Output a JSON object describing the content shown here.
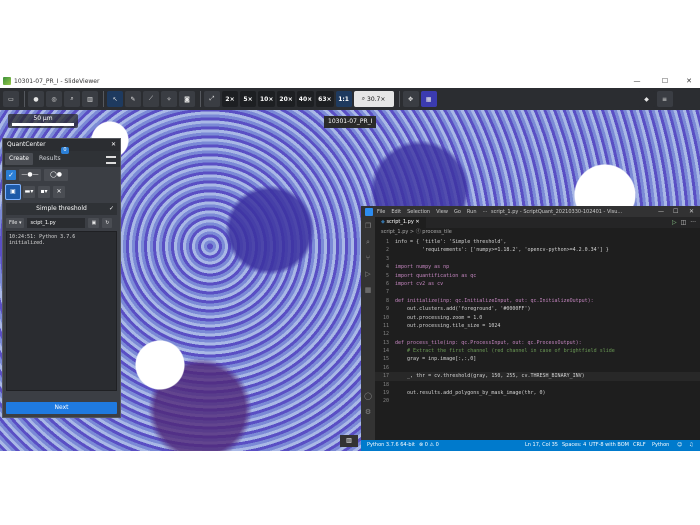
{
  "window": {
    "title": "10301-07_PR_I - SlideViewer",
    "controls": [
      "—",
      "☐",
      "✕"
    ]
  },
  "toolbar": {
    "zoom_levels": [
      "2×",
      "5×",
      "10×",
      "20×",
      "40×",
      "63×",
      "1:1"
    ],
    "zoom_value": "30.7×"
  },
  "viewer": {
    "scalebar_label": "50 μm",
    "slide_label": "10301-07_PR_I"
  },
  "quantcenter": {
    "title": "QuantCenter",
    "tabs": [
      {
        "label": "Create"
      },
      {
        "label": "Results",
        "badge": "0"
      }
    ],
    "section_title": "Simple threshold",
    "file_label": "File ▾",
    "script_name": "scipt_1.py",
    "console_line": "10:24:51: Python 3.7.6 initialized.",
    "next_label": "Next"
  },
  "vscode": {
    "menus": [
      "File",
      "Edit",
      "Selection",
      "View",
      "Go",
      "Run",
      "···"
    ],
    "title": "script_1.py - ScriptQuant_20210330-102401 - Visu...",
    "tab_label": "script_1.py",
    "breadcrumb": "script_1.py > ⓕ process_tile",
    "code": [
      {
        "n": "1",
        "t": "info = { 'title': 'Simple threshold',"
      },
      {
        "n": "2",
        "t": "         'requirements': ['numpy>=1.18.2', 'opencv-python>=4.2.0.34'] }"
      },
      {
        "n": "3",
        "t": ""
      },
      {
        "n": "4",
        "t": "import numpy as np"
      },
      {
        "n": "5",
        "t": "import quantification as qc"
      },
      {
        "n": "6",
        "t": "import cv2 as cv"
      },
      {
        "n": "7",
        "t": ""
      },
      {
        "n": "8",
        "t": "def initialize(inp: qc.InitializeInput, out: qc.InitializeOutput):"
      },
      {
        "n": "9",
        "t": "    out.clusters.add('foreground', '#0000FF')"
      },
      {
        "n": "10",
        "t": "    out.processing.zoom = 1.0"
      },
      {
        "n": "11",
        "t": "    out.processing.tile_size = 1024"
      },
      {
        "n": "12",
        "t": ""
      },
      {
        "n": "13",
        "t": "def process_tile(inp: qc.ProcessInput, out: qc.ProcessOutput):"
      },
      {
        "n": "14",
        "t": "    # Extract the first channel (red channel in case of brightfield slide"
      },
      {
        "n": "15",
        "t": "    gray = inp.image[:,:,0]"
      },
      {
        "n": "16",
        "t": ""
      },
      {
        "n": "17",
        "t": "    _, thr = cv.threshold(gray, 150, 255, cv.THRESH_BINARY_INV)"
      },
      {
        "n": "18",
        "t": ""
      },
      {
        "n": "19",
        "t": "    out.results.add_polygons_by_mask_image(thr, 0)"
      },
      {
        "n": "20",
        "t": ""
      }
    ],
    "status": {
      "python": "Python 3.7.6 64-bit",
      "problems": "⊗ 0 ⚠ 0",
      "position": "Ln 17, Col 35",
      "spaces": "Spaces: 4",
      "encoding": "UTF-8 with BOM",
      "eol": "CRLF",
      "language": "Python"
    }
  }
}
